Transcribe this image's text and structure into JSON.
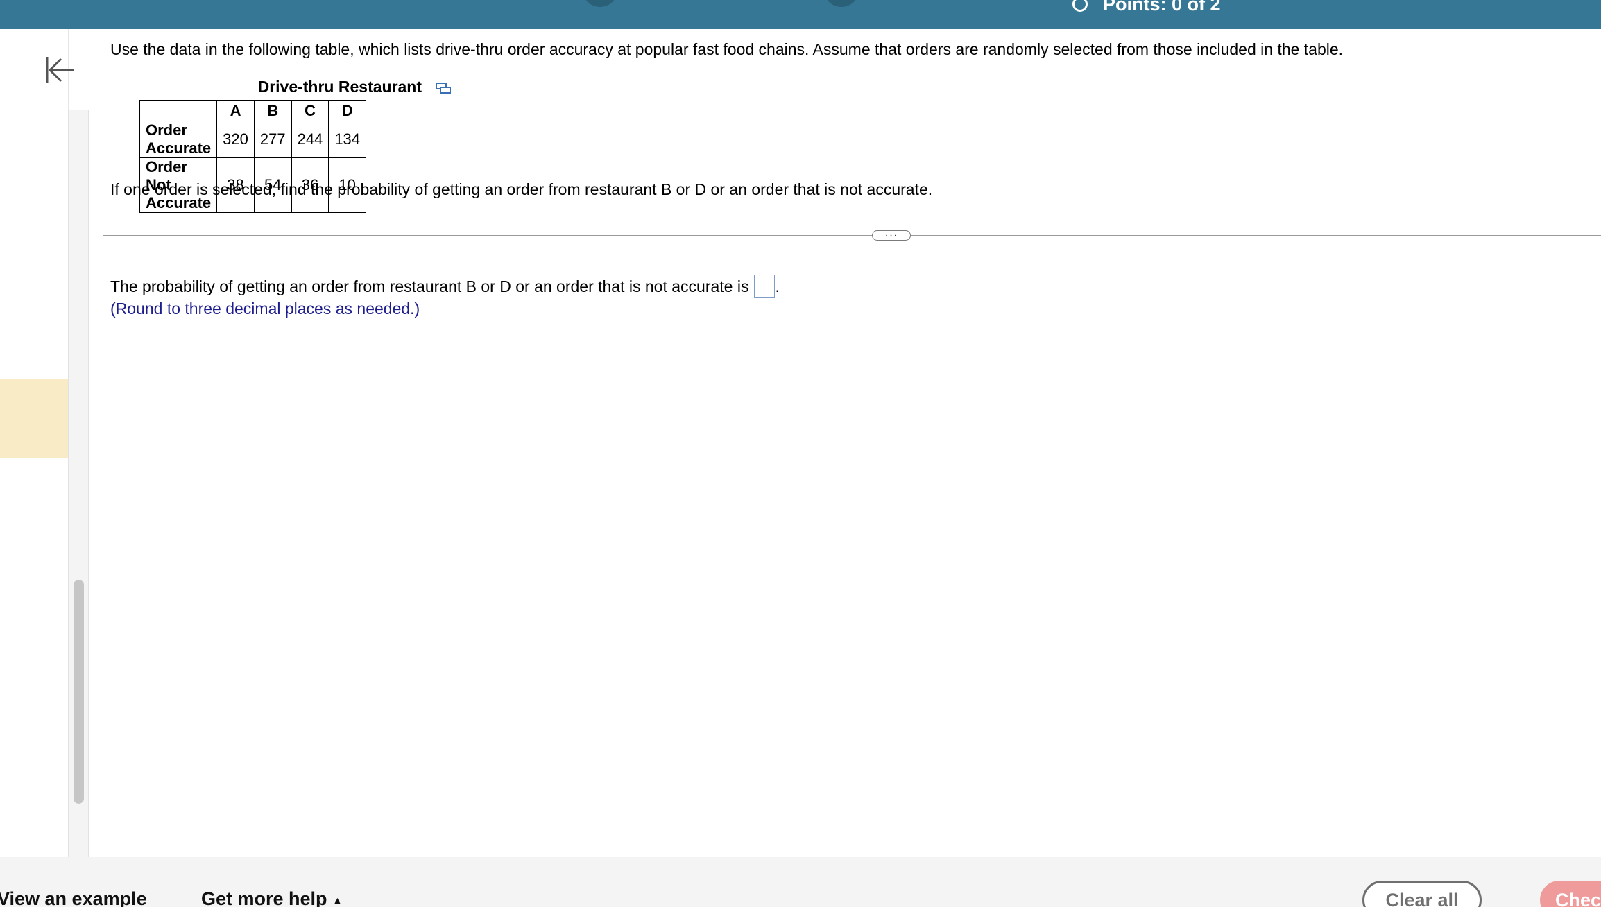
{
  "header": {
    "points_text": "Points: 0 of 2"
  },
  "question": {
    "intro": "Use the data in the following table, which lists drive-thru order accuracy at popular fast food chains. Assume that orders are randomly selected from those included in the table.",
    "table_title": "Drive-thru Restaurant",
    "columns": [
      "A",
      "B",
      "C",
      "D"
    ],
    "rows": [
      {
        "label": "Order Accurate",
        "values": [
          "320",
          "277",
          "244",
          "134"
        ]
      },
      {
        "label": "Order Not Accurate",
        "values": [
          "38",
          "54",
          "36",
          "10"
        ]
      }
    ],
    "prompt": "If one order is selected, find the probability of getting an order from restaurant B or D or an order that is not accurate."
  },
  "divider": {
    "more_label": "···"
  },
  "answer": {
    "sentence": "The probability of getting an order from restaurant B or D or an order that is not accurate is",
    "trailing_period": ".",
    "value": "",
    "hint": "(Round to three decimal places as needed.)"
  },
  "footer": {
    "view_example": "View an example",
    "get_more_help": "Get more help",
    "caret": "▲",
    "clear_all": "Clear all",
    "check_answer": "Chec"
  },
  "colors": {
    "header_bg": "#357794",
    "hint_text": "#1d1d8f",
    "highlight": "#f8ebc6",
    "check_btn": "#ef9b9b"
  }
}
